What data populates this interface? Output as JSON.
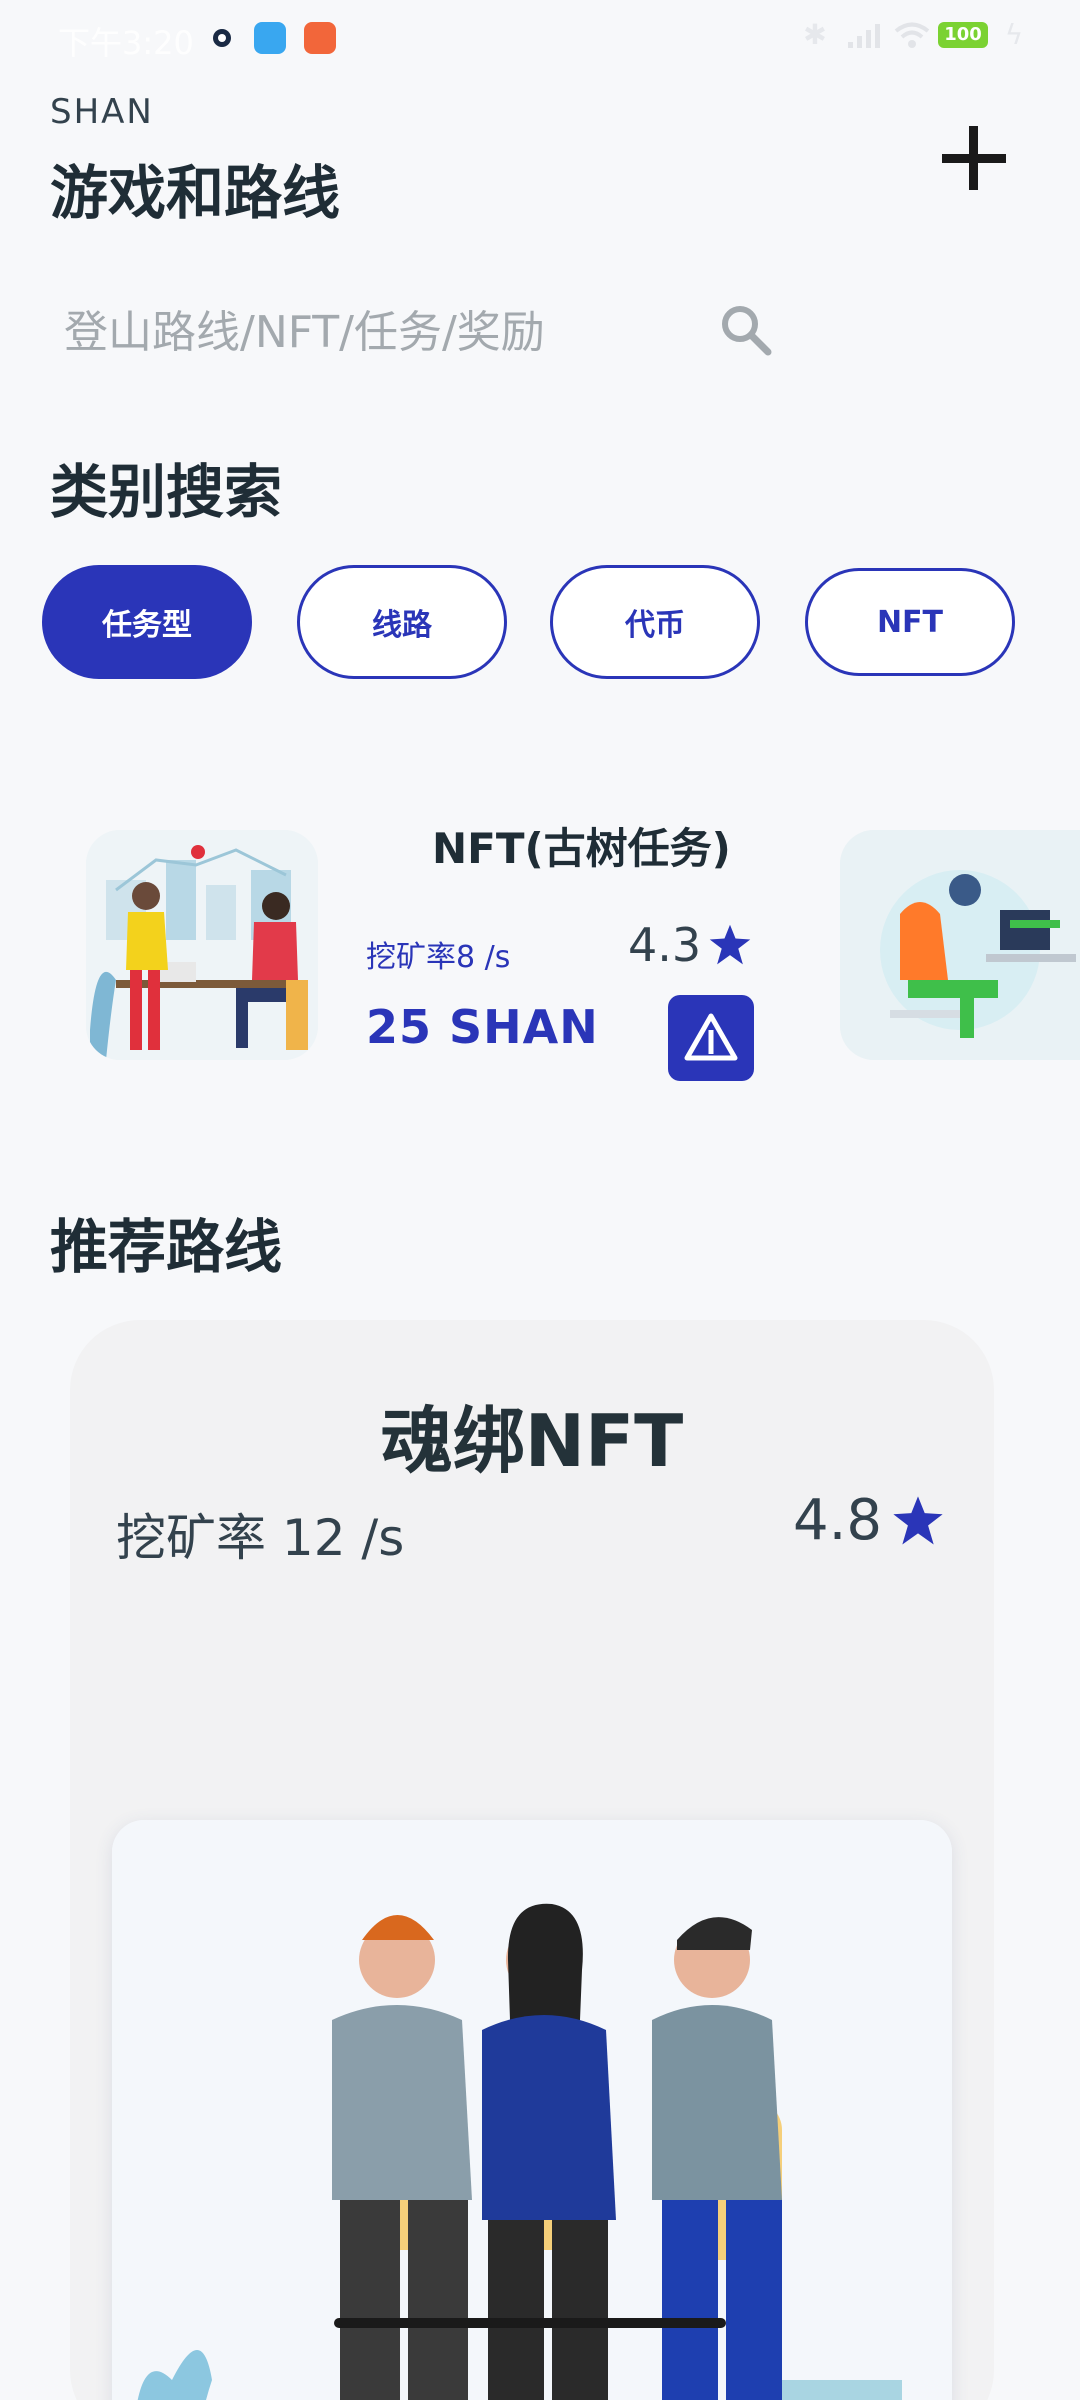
{
  "status_bar": {
    "time": "下午3:20",
    "battery": "100"
  },
  "header": {
    "brand": "SHAN",
    "title": "游戏和路线"
  },
  "search": {
    "placeholder": "登山路线/NFT/任务/奖励"
  },
  "categories": {
    "title": "类别搜索",
    "items": [
      {
        "label": "任务型",
        "active": true
      },
      {
        "label": "线路",
        "active": false
      },
      {
        "label": "代币",
        "active": false
      },
      {
        "label": "NFT",
        "active": false
      }
    ]
  },
  "task_card": {
    "title": "NFT(古树任务)",
    "rate": "挖矿率8 /s",
    "rating": "4.3",
    "reward": "25 SHAN"
  },
  "routes": {
    "title": "推荐路线",
    "card": {
      "title": "魂绑NFT",
      "rate": "挖矿率 12 /s",
      "rating": "4.8"
    }
  },
  "colors": {
    "accent": "#2a35b8",
    "text": "#1f2d36",
    "background": "#f7f8fa"
  },
  "icons": {
    "add": "plus-icon",
    "search": "search-icon",
    "rating": "star-icon",
    "action": "triangle-icon"
  }
}
